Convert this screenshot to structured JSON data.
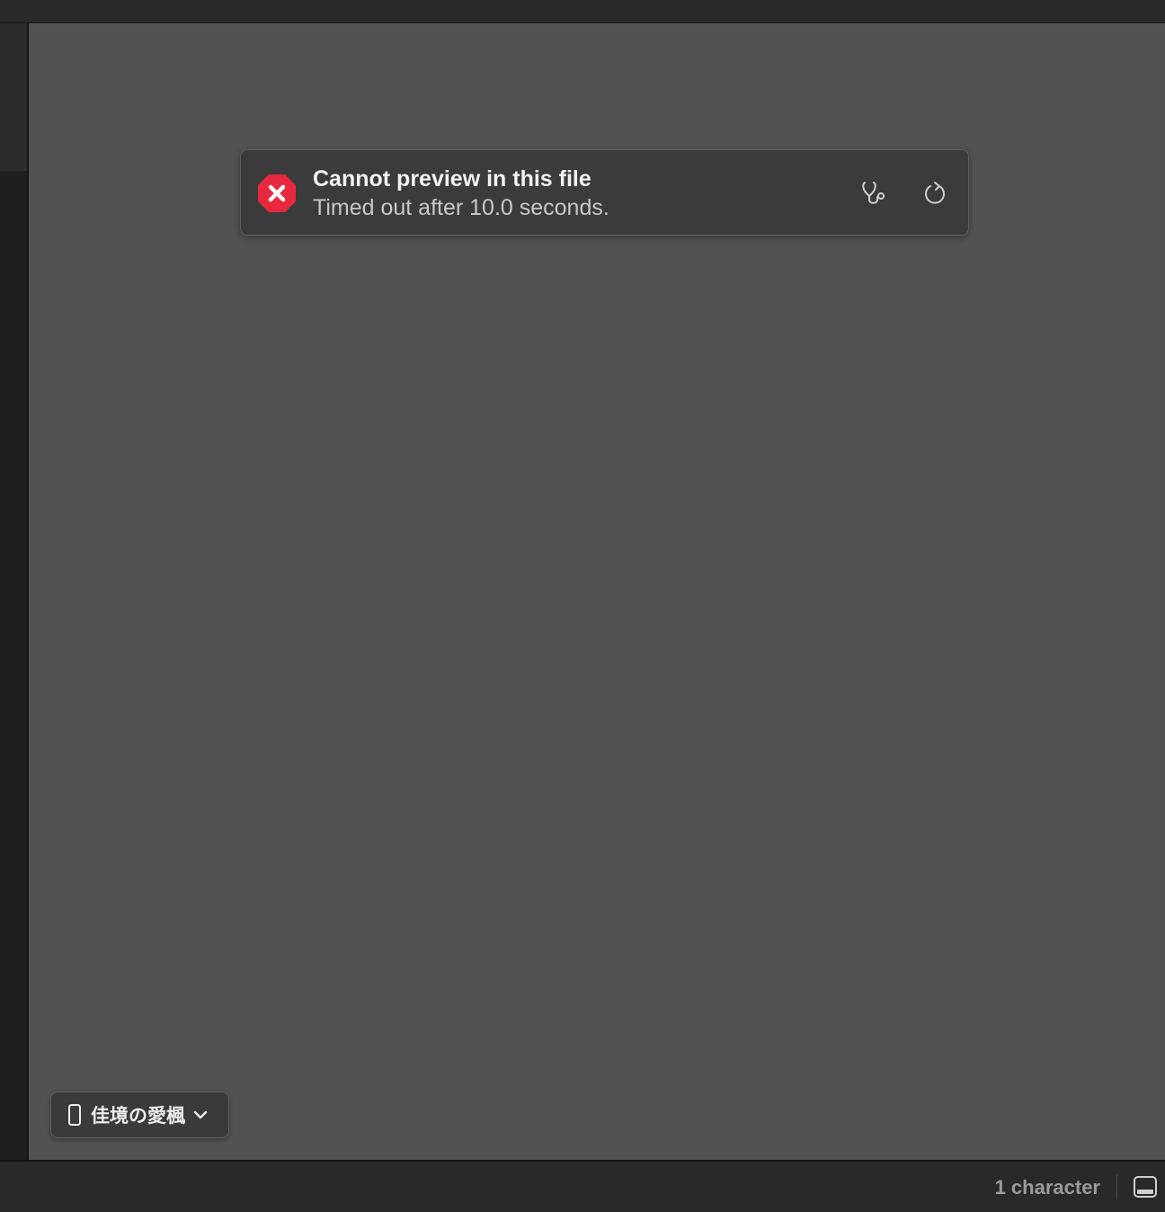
{
  "banner": {
    "title": "Cannot preview in this file",
    "subtitle": "Timed out after 10.0 seconds.",
    "error_color": "#e8283f"
  },
  "device_picker": {
    "label": "佳境の愛楓"
  },
  "status": {
    "char_count": "1 character"
  },
  "icons": {
    "error": "xmark-octagon-icon",
    "diagnose": "stethoscope-icon",
    "refresh": "refresh-icon",
    "device": "iphone-icon",
    "chevron": "chevron-down-icon",
    "panel": "bottom-panel-toggle-icon"
  }
}
